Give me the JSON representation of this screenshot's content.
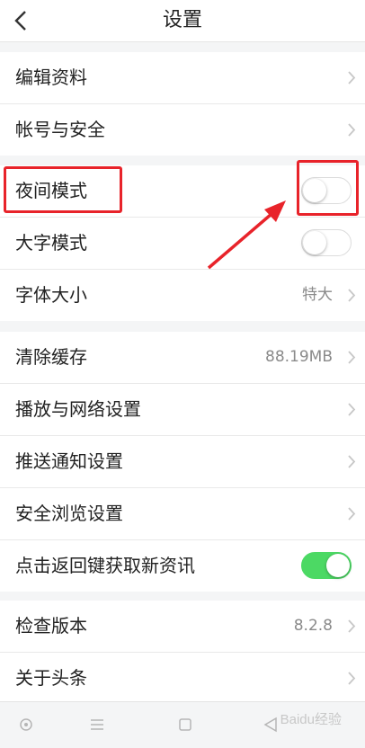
{
  "header": {
    "title": "设置",
    "back_icon": "chevron-left-icon"
  },
  "sections": [
    {
      "rows": [
        {
          "label": "编辑资料"
        },
        {
          "label": "帐号与安全"
        }
      ]
    },
    {
      "rows": [
        {
          "label": "夜间模式",
          "toggle": false
        },
        {
          "label": "大字模式",
          "toggle": false
        },
        {
          "label": "字体大小",
          "value": "特大"
        }
      ]
    },
    {
      "rows": [
        {
          "label": "清除缓存",
          "value": "88.19MB"
        },
        {
          "label": "播放与网络设置"
        },
        {
          "label": "推送通知设置"
        },
        {
          "label": "安全浏览设置"
        },
        {
          "label": "点击返回键获取新资讯",
          "toggle": true
        }
      ]
    },
    {
      "rows": [
        {
          "label": "检查版本",
          "value": "8.2.8"
        },
        {
          "label": "关于头条"
        }
      ]
    }
  ],
  "colors": {
    "highlight": "#e8232a",
    "toggle_on": "#4cd964"
  },
  "watermark": "Baidu经验"
}
